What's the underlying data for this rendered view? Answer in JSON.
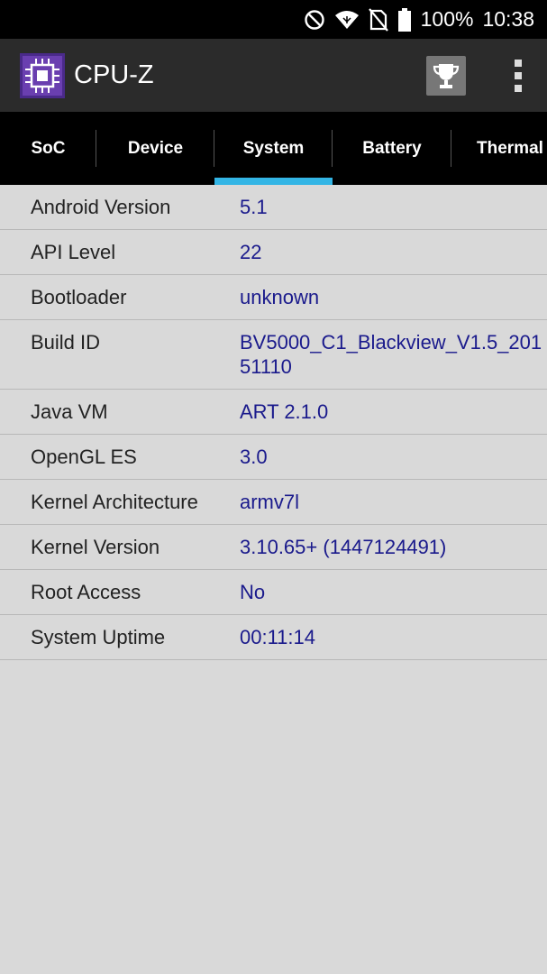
{
  "status_bar": {
    "battery_percent": "100%",
    "time": "10:38",
    "icons": [
      "do-not-disturb-icon",
      "wifi-icon",
      "no-sim-icon",
      "battery-icon"
    ]
  },
  "app_bar": {
    "title": "CPU-Z",
    "icons": [
      "cpu-chip-icon",
      "trophy-icon",
      "overflow-menu-icon"
    ]
  },
  "tabs": [
    {
      "label": "SoC",
      "active": false
    },
    {
      "label": "Device",
      "active": false
    },
    {
      "label": "System",
      "active": true
    },
    {
      "label": "Battery",
      "active": false
    },
    {
      "label": "Thermal",
      "active": false
    }
  ],
  "colors": {
    "accent": "#33b5e5",
    "value_text": "#1a1a8c",
    "background": "#d9d9d9"
  },
  "system_info": [
    {
      "label": "Android Version",
      "value": "5.1"
    },
    {
      "label": "API Level",
      "value": "22"
    },
    {
      "label": "Bootloader",
      "value": "unknown"
    },
    {
      "label": "Build ID",
      "value": "BV5000_C1_Blackview_V1.5_20151110"
    },
    {
      "label": "Java VM",
      "value": "ART 2.1.0"
    },
    {
      "label": "OpenGL ES",
      "value": "3.0"
    },
    {
      "label": "Kernel Architecture",
      "value": "armv7l"
    },
    {
      "label": "Kernel Version",
      "value": "3.10.65+ (1447124491)"
    },
    {
      "label": "Root Access",
      "value": "No"
    },
    {
      "label": "System Uptime",
      "value": "00:11:14"
    }
  ]
}
